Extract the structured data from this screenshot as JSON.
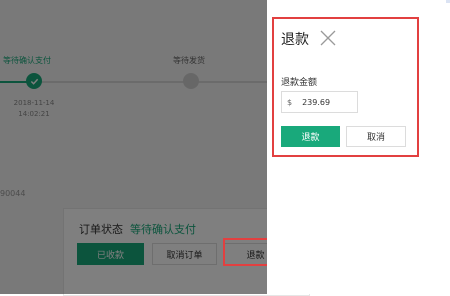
{
  "progress": {
    "step1": {
      "label": "等待确认支付",
      "date": "2018-11-14",
      "time": "14:02:21"
    },
    "step2": {
      "label": "等待发货"
    }
  },
  "order_id_partial": "90044",
  "order_panel": {
    "status_label": "订单状态",
    "status_value": "等待确认支付",
    "buttons": {
      "received": "已收款",
      "cancel_order": "取消订单",
      "refund": "退款"
    }
  },
  "refund_drawer": {
    "title": "退款",
    "amount_label": "退款金额",
    "currency_symbol": "$",
    "amount_value": "239.69",
    "confirm_label": "退款",
    "cancel_label": "取消"
  },
  "colors": {
    "accent": "#19a97b",
    "highlight": "#e24040"
  }
}
